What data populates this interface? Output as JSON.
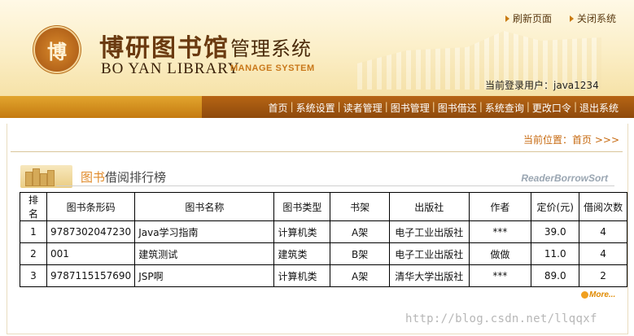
{
  "header": {
    "logo_char": "博",
    "title_cn": "博研图书馆",
    "title_manage": "管理系统",
    "title_en": "BO YAN LIBRARY",
    "title_en2": "MANAGE SYSTEM",
    "toplinks": [
      "刷新页面",
      "关闭系统"
    ],
    "user_label": "当前登录用户：",
    "user_name": "java1234"
  },
  "nav": [
    "首页",
    "系统设置",
    "读者管理",
    "图书管理",
    "图书借还",
    "系统查询",
    "更改口令",
    "退出系统"
  ],
  "location": "当前位置：首页 >>>",
  "section": {
    "title_highlight": "图书",
    "title_rest": "借阅排行榜",
    "title_en": "ReaderBorrowSort"
  },
  "table": {
    "headers": [
      "排名",
      "图书条形码",
      "图书名称",
      "图书类型",
      "书架",
      "出版社",
      "作者",
      "定价(元)",
      "借阅次数"
    ],
    "rows": [
      [
        "1",
        "9787302047230",
        "Java学习指南",
        "计算机类",
        "A架",
        "电子工业出版社",
        "***",
        "39.0",
        "4"
      ],
      [
        "2",
        "001",
        "建筑测试",
        "建筑类",
        "B架",
        "电子工业出版社",
        "做做",
        "11.0",
        "4"
      ],
      [
        "3",
        "9787115157690",
        "JSP啊",
        "计算机类",
        "A架",
        "清华大学出版社",
        "***",
        "89.0",
        "2"
      ]
    ]
  },
  "more_label": "More...",
  "watermark": "http://blog.csdn.net/llqqxf"
}
